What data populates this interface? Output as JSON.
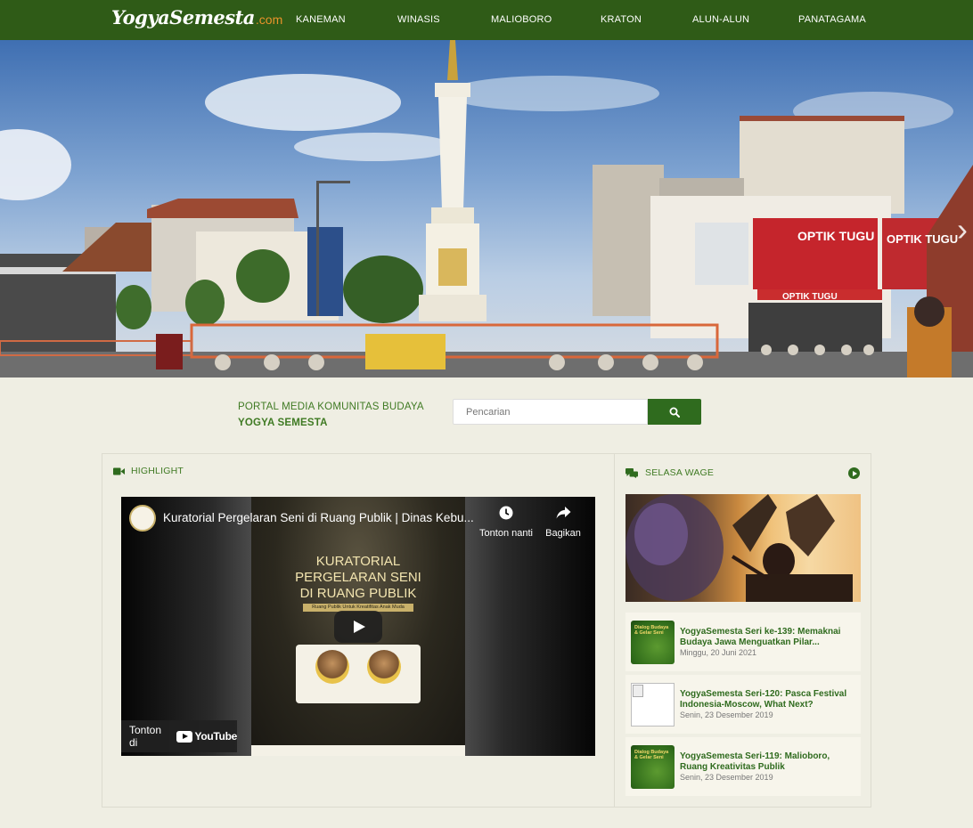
{
  "nav": {
    "logo_main": "YogyaSemesta",
    "logo_ext": ".com",
    "items": [
      "KANEMAN",
      "WINASIS",
      "MALIOBORO",
      "KRATON",
      "ALUN-ALUN",
      "PANATAGAMA"
    ]
  },
  "hero": {
    "signs": [
      "OPTIK TUGU",
      "OPTIK TUGU",
      "OPTIK TUGU"
    ],
    "next_icon": "chevron-right-icon"
  },
  "portal": {
    "tagline": "PORTAL MEDIA KOMUNITAS BUDAYA",
    "name": "YOGYA SEMESTA"
  },
  "search": {
    "placeholder": "Pencarian",
    "icon": "search-icon"
  },
  "highlight": {
    "title": "HIGHLIGHT",
    "icon": "video-camera-icon",
    "video": {
      "title": "Kuratorial Pergelaran Seni di Ruang Publik | Dinas Kebu...",
      "watch_later": "Tonton nanti",
      "share": "Bagikan",
      "watch_on": "Tonton di",
      "youtube": "YouTube",
      "poster_title": "KURATORIAL\nPERGELARAN SENI\nDI RUANG PUBLIK",
      "poster_band": "Ruang Publik Untuk Kreatifitas Anak Muda"
    }
  },
  "selasa_wage": {
    "title": "SELASA WAGE",
    "icon": "chat-bubbles-icon",
    "arrow_icon": "arrow-right-circle-icon",
    "articles": [
      {
        "title": "YogyaSemesta Seri ke-139: Memaknai Budaya Jawa Menguatkan Pilar...",
        "date": "Minggu, 20 Juni 2021",
        "thumb_text": "Dialog Budaya\n& Gelar Seni"
      },
      {
        "title": "YogyaSemesta Seri-120: Pasca Festival Indonesia-Moscow, What Next?",
        "date": "Senin, 23 Desember 2019",
        "thumb_text": ""
      },
      {
        "title": "YogyaSemesta Seri-119: Malioboro, Ruang Kreativitas Publik",
        "date": "Senin, 23 Desember 2019",
        "thumb_text": "Dialog Budaya\n& Gelar Seni"
      }
    ]
  },
  "colors": {
    "nav_bg": "#2f5b17",
    "accent_green": "#3f7a23",
    "button_green": "#2f6b1e",
    "logo_orange": "#e9932b",
    "page_bg": "#efeee3"
  }
}
